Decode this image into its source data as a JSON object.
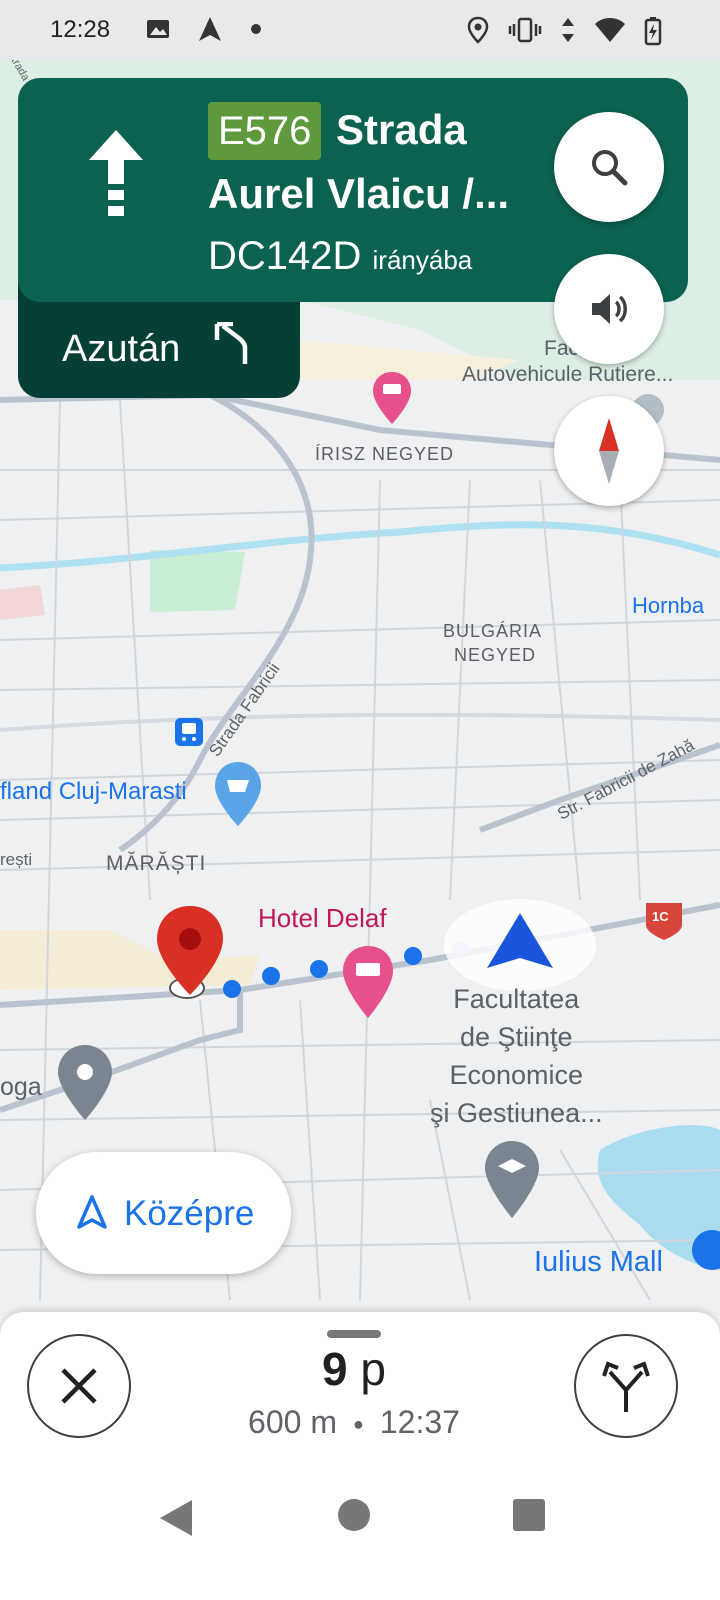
{
  "status_bar": {
    "time": "12:28"
  },
  "nav": {
    "route_shield": "E576",
    "street_line1": "Strada",
    "street_line2": "Aurel Vlaicu /...",
    "towards_road": "DC142D",
    "towards_suffix": "irányába",
    "then_label": "Azután"
  },
  "map": {
    "labels": {
      "strada_small": "Strada",
      "faculty_auto_1": "Fac de",
      "faculty_auto_2": "Autovehicule Rutiere...",
      "irisz": "ÍRISZ NEGYED",
      "hornba": "Hornba",
      "bulgaria_1": "BULGÁRIA",
      "bulgaria_2": "NEGYED",
      "strada_fabricii": "Strada Fabricii",
      "kaufland": "fland Cluj-Marasti",
      "str_fabricii_zahar": "Str. Fabricii de Zahă",
      "resti": "rești",
      "marasti": "MĂRĂȘTI",
      "hotel_delaf": "Hotel Delaf",
      "route_badge": "1C",
      "faculty_econ": "Facultatea\nde Ştiinţe\nEconomice\nşi Gestiunea...",
      "oga": "oga",
      "iulius": "Iulius Mall"
    }
  },
  "controls": {
    "recenter_label": "Középre"
  },
  "eta": {
    "minutes": "9",
    "minutes_unit": "p",
    "distance": "600 m",
    "arrival": "12:37"
  },
  "colors": {
    "nav_green": "#0b6251",
    "then_green": "#063f36",
    "shield_green": "#5e9a3c",
    "route_blue": "#1a73e8",
    "pin_red": "#d93025"
  }
}
